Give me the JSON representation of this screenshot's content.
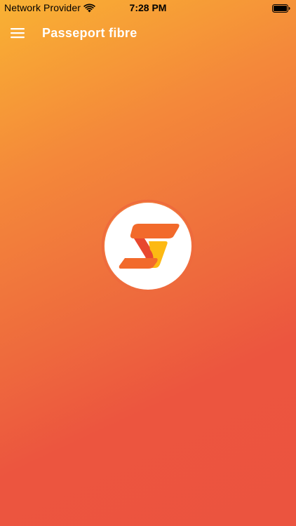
{
  "status_bar": {
    "carrier": "Network Provider",
    "time": "7:28 PM",
    "wifi_icon": "wifi-icon",
    "battery_icon": "battery-icon"
  },
  "nav_bar": {
    "menu_icon": "hamburger-menu-icon",
    "title": "Passeport fibre"
  },
  "logo": {
    "icon": "s-brand-logo-icon"
  },
  "colors": {
    "gradient_top": "#f9b233",
    "gradient_bottom": "#eb543f",
    "logo_orange": "#f26a2b",
    "logo_red": "#e8482f",
    "logo_yellow": "#fdb913",
    "ring": "#ee6a3d"
  }
}
